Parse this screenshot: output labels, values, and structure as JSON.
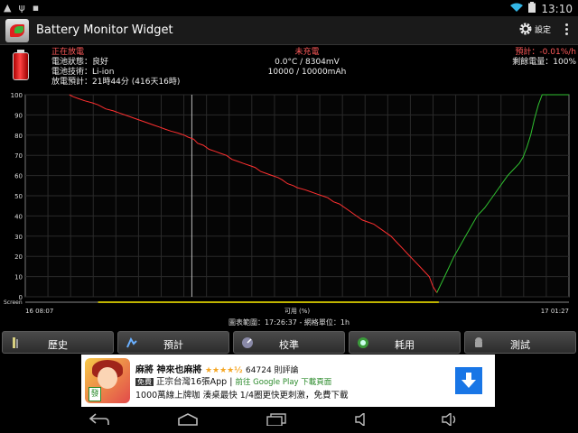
{
  "statusbar": {
    "time": "13:10"
  },
  "actionbar": {
    "title": "Battery Monitor Widget",
    "settings_label": "設定"
  },
  "info": {
    "left": {
      "status": "正在放電",
      "health": "電池狀態：良好",
      "tech": "電池技術：Li-ion",
      "estimate": "放電預計：21時44分 (416天16時)"
    },
    "mid": {
      "charge_status": "未充電",
      "temp_voltage": "0.0°C / 8304mV",
      "capacity": "10000 / 10000mAh"
    },
    "right": {
      "forecast": "預計：-0.01%/h",
      "remaining": "剩餘電量：100%"
    }
  },
  "chart_range_text": "圖表範圍：17:26:37 - 網格單位：1h",
  "tabs": [
    {
      "label": "歷史"
    },
    {
      "label": "預計"
    },
    {
      "label": "校準"
    },
    {
      "label": "耗用"
    },
    {
      "label": "測試"
    }
  ],
  "ad": {
    "title": "麻將 神來也麻將",
    "stars": "★★★★½",
    "reviews": "64724 則評論",
    "free_badge": "免費",
    "subtitle": "正宗台灣16張App",
    "gp_text": "前往 Google Play 下載頁面",
    "line3": "1000萬線上牌咖 湊桌最快 1/4圈更快更刺激，免費下載"
  },
  "colors": {
    "discharge": "#ff3030",
    "charge": "#30c030",
    "screen": "#bfb400",
    "grid": "#2a2a2a"
  },
  "chart_data": {
    "type": "line",
    "y_ticks": [
      "100",
      "90",
      "80",
      "70",
      "60",
      "50",
      "40",
      "30",
      "20",
      "10",
      "0"
    ],
    "ylim": [
      0,
      100
    ],
    "x_start_label": "16 08:07",
    "x_end_label": "17 01:27",
    "x_mid_label": "可用 (%)",
    "screen_label": "Screen",
    "series": [
      {
        "values": [
          [
            0.115,
            100
          ],
          [
            0.125,
            99
          ],
          [
            0.14,
            98
          ],
          [
            0.155,
            97
          ],
          [
            0.175,
            96
          ],
          [
            0.19,
            95
          ],
          [
            0.2,
            94
          ],
          [
            0.21,
            93
          ],
          [
            0.23,
            92
          ],
          [
            0.245,
            91
          ],
          [
            0.26,
            90
          ],
          [
            0.275,
            89
          ],
          [
            0.29,
            88
          ],
          [
            0.305,
            87
          ],
          [
            0.32,
            86
          ],
          [
            0.335,
            85
          ],
          [
            0.35,
            84
          ],
          [
            0.365,
            83
          ],
          [
            0.38,
            82
          ],
          [
            0.4,
            81
          ],
          [
            0.415,
            80
          ],
          [
            0.425,
            79
          ],
          [
            0.44,
            78
          ],
          [
            0.45,
            76
          ],
          [
            0.465,
            75
          ],
          [
            0.48,
            73
          ],
          [
            0.495,
            72
          ],
          [
            0.51,
            71
          ],
          [
            0.525,
            70
          ],
          [
            0.54,
            68
          ],
          [
            0.555,
            67
          ],
          [
            0.57,
            66
          ],
          [
            0.585,
            65
          ],
          [
            0.6,
            64
          ],
          [
            0.615,
            62
          ],
          [
            0.63,
            61
          ],
          [
            0.645,
            60
          ],
          [
            0.66,
            59
          ],
          [
            0.67,
            58
          ],
          [
            0.685,
            56
          ],
          [
            0.7,
            55
          ],
          [
            0.71,
            54
          ],
          [
            0.73,
            53
          ],
          [
            0.745,
            52
          ],
          [
            0.76,
            51
          ],
          [
            0.775,
            50
          ],
          [
            0.79,
            49
          ],
          [
            0.805,
            47
          ],
          [
            0.82,
            46
          ],
          [
            0.835,
            44
          ],
          [
            0.85,
            42
          ],
          [
            0.865,
            40
          ],
          [
            0.88,
            38
          ],
          [
            0.895,
            37
          ],
          [
            0.91,
            36
          ],
          [
            0.925,
            34
          ],
          [
            0.94,
            32
          ],
          [
            0.955,
            30
          ],
          [
            0.97,
            27
          ],
          [
            0.985,
            24
          ],
          [
            1.0,
            21
          ],
          [
            1.015,
            18
          ],
          [
            1.03,
            15
          ],
          [
            1.045,
            12
          ],
          [
            1.055,
            10
          ],
          [
            1.065,
            5
          ],
          [
            1.075,
            2
          ]
        ]
      },
      {
        "values": [
          [
            1.075,
            2
          ],
          [
            1.09,
            8
          ],
          [
            1.105,
            14
          ],
          [
            1.12,
            20
          ],
          [
            1.135,
            25
          ],
          [
            1.15,
            30
          ],
          [
            1.165,
            35
          ],
          [
            1.18,
            40
          ],
          [
            1.2,
            44
          ],
          [
            1.215,
            48
          ],
          [
            1.23,
            52
          ],
          [
            1.245,
            56
          ],
          [
            1.26,
            60
          ],
          [
            1.275,
            63
          ],
          [
            1.29,
            66
          ],
          [
            1.3,
            69
          ],
          [
            1.31,
            74
          ],
          [
            1.32,
            80
          ],
          [
            1.33,
            88
          ],
          [
            1.34,
            95
          ],
          [
            1.35,
            100
          ],
          [
            1.42,
            100
          ]
        ]
      }
    ]
  }
}
